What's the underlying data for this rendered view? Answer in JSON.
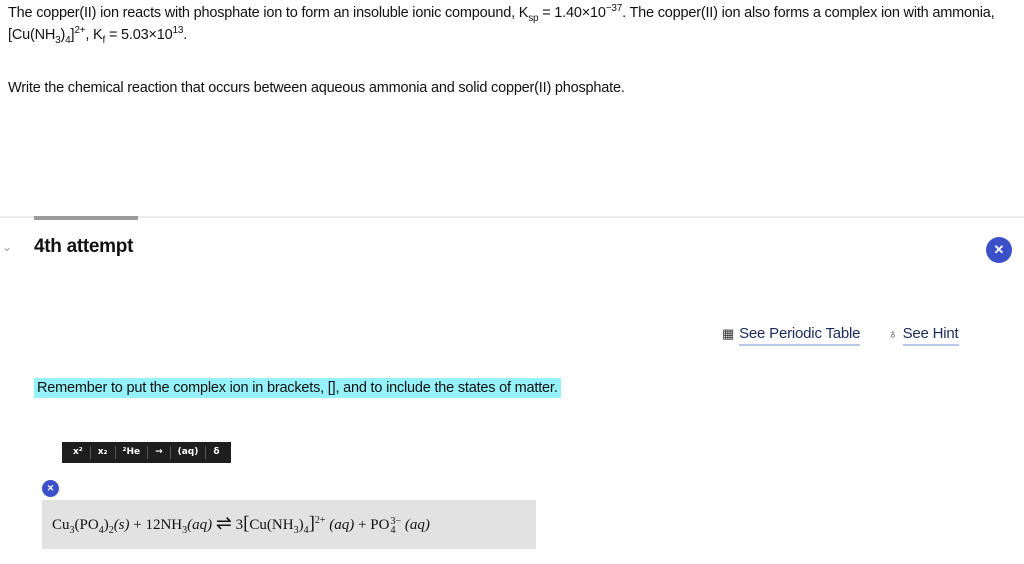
{
  "question": {
    "s1": "The copper(II) ion reacts with phosphate ion to form an insoluble ionic compound, K",
    "ksp_sub": "sp",
    "s2": " = 1.40×10",
    "ksp_exp": "−37",
    "s3": ". The copper(II) ion also forms a complex ion with ammonia, [Cu(NH",
    "nh3_sub": "3",
    "s4": ")",
    "four_sub": "4",
    "s5": "]",
    "charge_sup": "2+",
    "s6": ", K",
    "kf_sub": "f",
    "s7": " = 5.03×10",
    "kf_exp": "13",
    "s8": ".",
    "prompt": "Write the chemical reaction that occurs between aqueous ammonia and solid copper(II) phosphate."
  },
  "attempt": {
    "label": "4th attempt"
  },
  "tools": {
    "periodic_table": "See Periodic Table",
    "hint": "See Hint"
  },
  "hint_banner": "Remember to put the complex ion in brackets, [], and to include the states of matter.",
  "toolbar": {
    "buttons": [
      "x²",
      "x₂",
      "²He",
      "→",
      "(aq)",
      "δ"
    ]
  },
  "equation": {
    "cu": "Cu",
    "sub3": "3",
    "po4open": "(PO",
    "sub4": "4",
    "close": ")",
    "sub2": "2",
    "s_state": "(s)",
    "plus1": " + 12NH",
    "nh_sub": "3",
    "aq1": "(aq)",
    "arrow": "⇌",
    "three": " 3",
    "lbr": "[",
    "cu2": "Cu",
    "nh_open": "(NH",
    "nh_sub2": "3",
    "nh_close": ")",
    "nh_sub4": "4",
    "rbr": "]",
    "charge": "2+",
    "aq2": "(aq)",
    "plus2": " + PO",
    "po_sup": "3−",
    "po_sub": "4",
    "aq3": "(aq)"
  },
  "colors": {
    "accent": "#3b50c8",
    "hint_bg": "#96f2fa",
    "toolbar_bg": "#1e1e1e",
    "eq_bg": "#e2e2e2"
  }
}
